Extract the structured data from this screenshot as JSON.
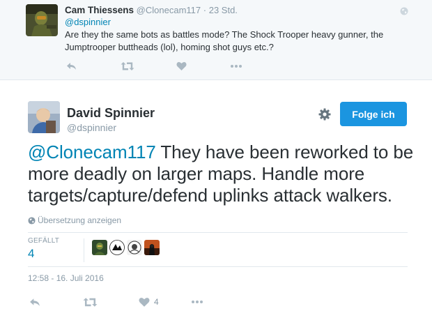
{
  "parent_tweet": {
    "name": "Cam Thiessens",
    "handle": "@Clonecam117",
    "separator": "·",
    "time": "23 Std.",
    "reply_to": "@dspinnier",
    "text": "Are they the same bots as battles mode? The Shock Trooper heavy gunner, the Jumptrooper buttheads (lol), homing shot guys etc.?",
    "icons": [
      "reply-icon",
      "retweet-icon",
      "like-icon",
      "more-icon"
    ]
  },
  "main_tweet": {
    "name": "David Spinnier",
    "handle": "@dspinnier",
    "follow_label": "Folge ich",
    "text_mention": "@Clonecam117",
    "text_body": " They have been reworked to be more deadly on larger maps. Handle more targets/capture/defend uplinks attack walkers.",
    "translate_label": "Übersetzung anzeigen",
    "likes_label": "GEFÄLLT",
    "likes_count": "4",
    "timestamp": "12:58 - 16. Juli 2016",
    "action_like_count": "4",
    "icons": [
      "reply-icon",
      "retweet-icon",
      "like-icon",
      "more-icon",
      "gear-icon",
      "globe-icon"
    ]
  },
  "colors": {
    "link": "#0084b4",
    "button": "#1b95e0",
    "muted": "#8899a6",
    "text": "#292f33",
    "parent_bg": "#f5f8fa"
  }
}
